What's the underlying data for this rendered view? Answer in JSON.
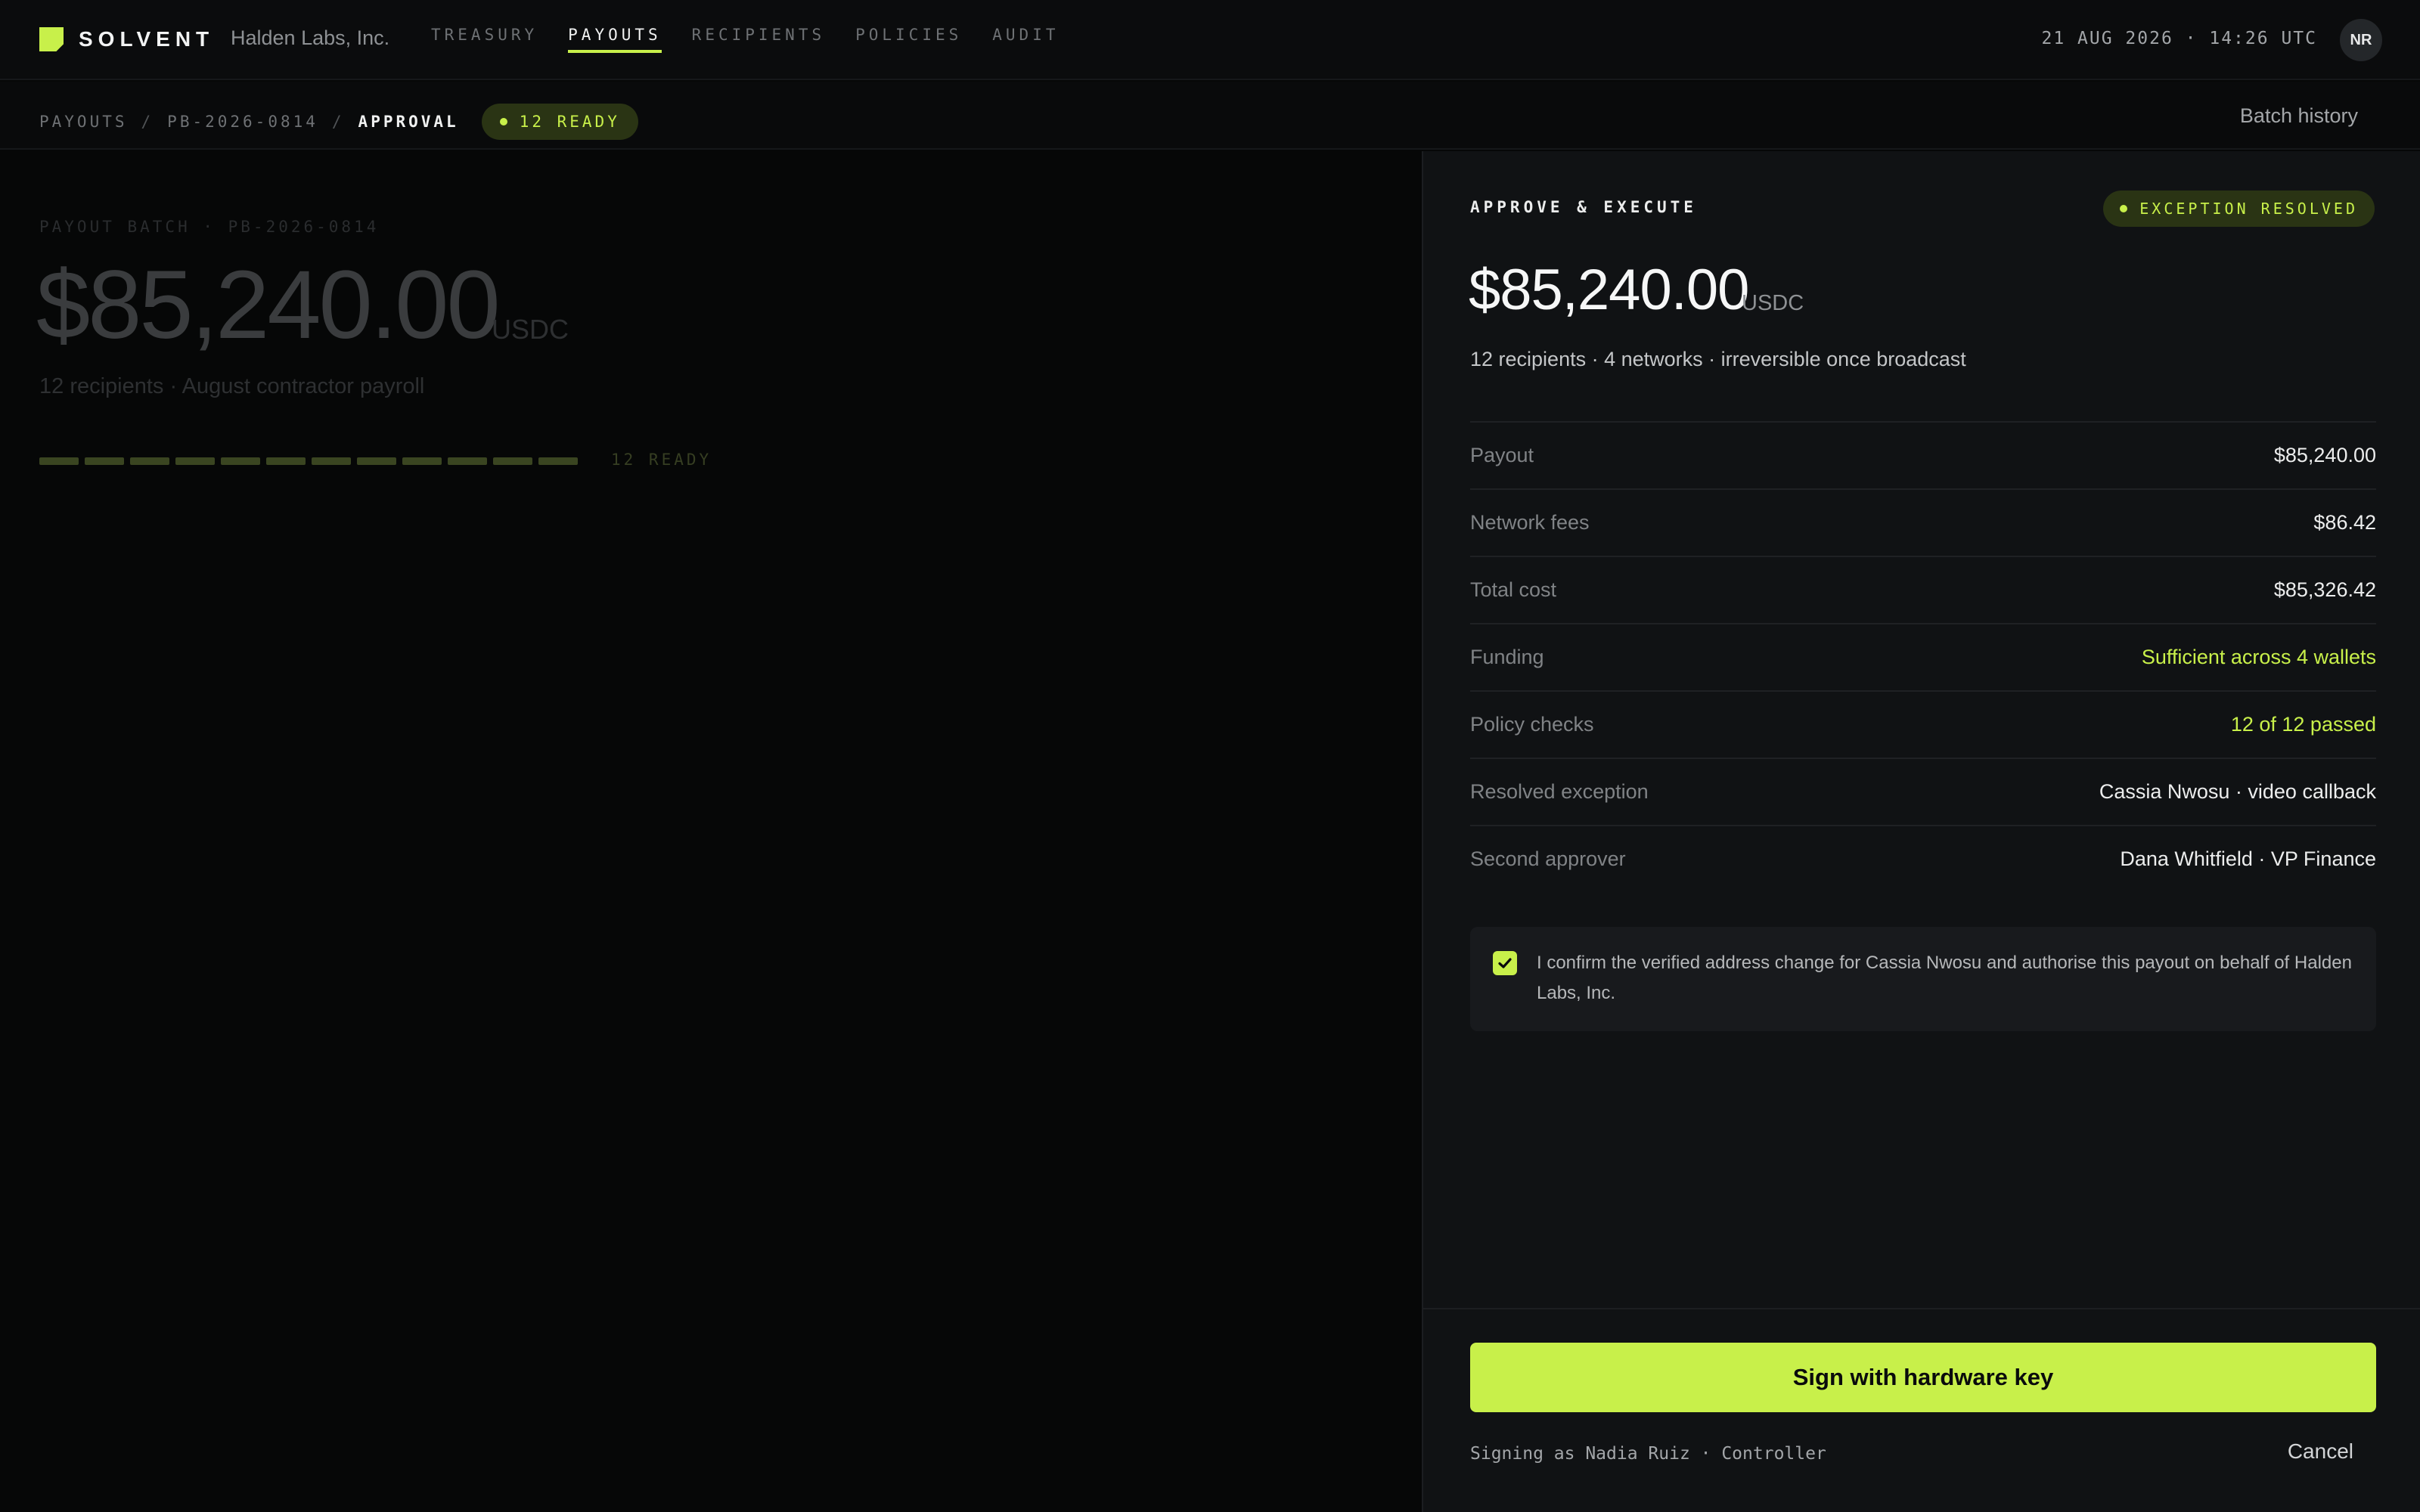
{
  "app": {
    "brand": "SOLVENT",
    "org": "Halden Labs, Inc."
  },
  "nav": {
    "items": [
      {
        "label": "TREASURY",
        "active": false
      },
      {
        "label": "PAYOUTS",
        "active": true
      },
      {
        "label": "RECIPIENTS",
        "active": false
      },
      {
        "label": "POLICIES",
        "active": false
      },
      {
        "label": "AUDIT",
        "active": false
      }
    ]
  },
  "header": {
    "datetime": "21 AUG 2026 · 14:26 UTC",
    "avatar_initials": "NR"
  },
  "breadcrumb": {
    "items": [
      "PAYOUTS",
      "PB-2026-0814",
      "APPROVAL"
    ],
    "separator": "/",
    "status": "12 READY",
    "batch_history": "Batch history"
  },
  "background": {
    "label": "PAYOUT BATCH · PB-2026-0814",
    "amount": "$85,240.00",
    "currency": "USDC",
    "subtitle": "12 recipients · August contractor payroll",
    "ready_count": 12,
    "ready_label": "12 READY"
  },
  "panel": {
    "title": "APPROVE & EXECUTE",
    "badge": "EXCEPTION RESOLVED",
    "amount": "$85,240.00",
    "currency": "USDC",
    "subtitle": "12 recipients · 4 networks · irreversible once broadcast",
    "rows": [
      {
        "key": "Payout",
        "value": "$85,240.00",
        "highlight": false
      },
      {
        "key": "Network fees",
        "value": "$86.42",
        "highlight": false
      },
      {
        "key": "Total cost",
        "value": "$85,326.42",
        "highlight": false
      },
      {
        "key": "Funding",
        "value": "Sufficient across 4 wallets",
        "highlight": true
      },
      {
        "key": "Policy checks",
        "value": "12 of 12 passed",
        "highlight": true
      },
      {
        "key": "Resolved exception",
        "value": "Cassia Nwosu · video callback",
        "highlight": false
      },
      {
        "key": "Second approver",
        "value": "Dana Whitfield · VP Finance",
        "highlight": false
      }
    ],
    "confirm_checked": true,
    "confirm_text": "I confirm the verified address change for Cassia Nwosu and authorise this payout on behalf of Halden Labs, Inc.",
    "sign_button": "Sign with hardware key",
    "signing_as": "Signing as Nadia Ruiz · Controller",
    "cancel": "Cancel"
  },
  "colors": {
    "accent": "#c8f04a",
    "background": "#060707",
    "panel": "#101214"
  }
}
